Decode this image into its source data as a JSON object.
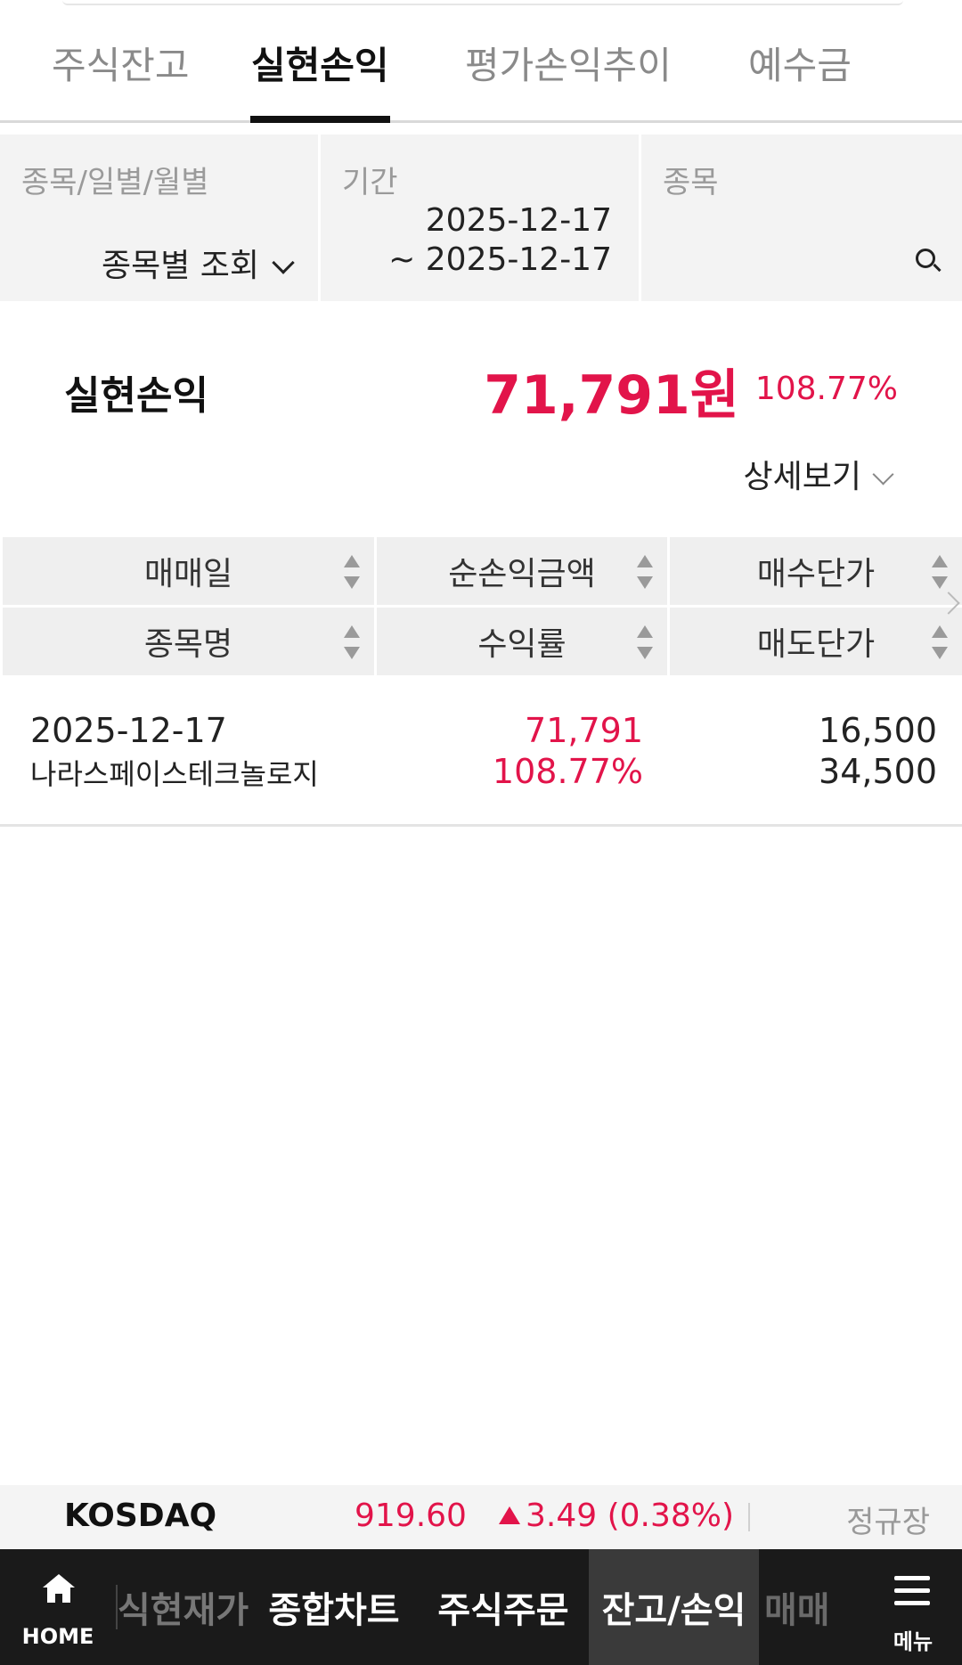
{
  "tabs": [
    {
      "label": "주식잔고"
    },
    {
      "label": "실현손익"
    },
    {
      "label": "평가손익추이"
    },
    {
      "label": "예수금"
    }
  ],
  "filter": {
    "type_label": "종목/일별/월별",
    "type_value": "종목별 조회",
    "period_label": "기간",
    "period_from": "2025-12-17",
    "period_to": "~ 2025-12-17",
    "stock_label": "종목"
  },
  "summary": {
    "label": "실현손익",
    "amount": "71,791원",
    "rate": "108.77%",
    "detail_label": "상세보기"
  },
  "table": {
    "headers_row1": [
      "매매일",
      "순손익금액",
      "매수단가"
    ],
    "headers_row2": [
      "종목명",
      "수익률",
      "매도단가"
    ],
    "rows": [
      {
        "date": "2025-12-17",
        "name": "나라스페이스테크놀로지",
        "net_profit": "71,791",
        "rate": "108.77%",
        "buy_price": "16,500",
        "sell_price": "34,500"
      }
    ]
  },
  "market": {
    "name": "KOSDAQ",
    "price": "919.60",
    "change": "3.49 (0.38%)",
    "session": "정규장"
  },
  "bottom_nav": {
    "home": "HOME",
    "items": [
      "식현재가",
      "종합차트",
      "주식주문",
      "잔고/손익",
      "매매"
    ],
    "menu": "메뉴"
  },
  "colors": {
    "up": "#e2144a",
    "nav_bg": "#1a1a1a"
  }
}
